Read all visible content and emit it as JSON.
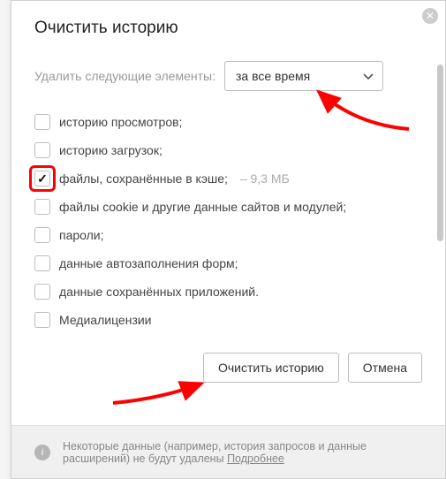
{
  "title": "Очистить историю",
  "timeRange": {
    "label": "Удалить следующие элементы:",
    "selected": "за все время"
  },
  "items": [
    {
      "label": "историю просмотров;",
      "checked": false
    },
    {
      "label": "историю загрузок;",
      "checked": false
    },
    {
      "label": "файлы, сохранённые в кэше;",
      "checked": true,
      "meta": "–  9,3 МБ"
    },
    {
      "label": "файлы cookie и другие данные сайтов и модулей;",
      "checked": false
    },
    {
      "label": "пароли;",
      "checked": false
    },
    {
      "label": "данные автозаполнения форм;",
      "checked": false
    },
    {
      "label": "данные сохранённых приложений.",
      "checked": false
    },
    {
      "label": "Медиалицензии",
      "checked": false
    }
  ],
  "buttons": {
    "clear": "Очистить историю",
    "cancel": "Отмена"
  },
  "footer": {
    "text": "Некоторые данные (например, история запросов и данные расширений) не будут удалены ",
    "link": "Подробнее"
  }
}
